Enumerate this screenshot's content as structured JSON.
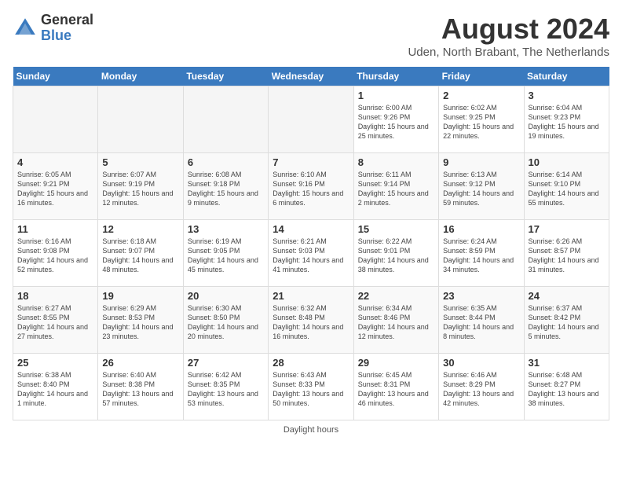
{
  "header": {
    "logo_general": "General",
    "logo_blue": "Blue",
    "title": "August 2024",
    "location": "Uden, North Brabant, The Netherlands"
  },
  "days_of_week": [
    "Sunday",
    "Monday",
    "Tuesday",
    "Wednesday",
    "Thursday",
    "Friday",
    "Saturday"
  ],
  "weeks": [
    [
      {
        "day": "",
        "info": ""
      },
      {
        "day": "",
        "info": ""
      },
      {
        "day": "",
        "info": ""
      },
      {
        "day": "",
        "info": ""
      },
      {
        "day": "1",
        "info": "Sunrise: 6:00 AM\nSunset: 9:26 PM\nDaylight: 15 hours\nand 25 minutes."
      },
      {
        "day": "2",
        "info": "Sunrise: 6:02 AM\nSunset: 9:25 PM\nDaylight: 15 hours\nand 22 minutes."
      },
      {
        "day": "3",
        "info": "Sunrise: 6:04 AM\nSunset: 9:23 PM\nDaylight: 15 hours\nand 19 minutes."
      }
    ],
    [
      {
        "day": "4",
        "info": "Sunrise: 6:05 AM\nSunset: 9:21 PM\nDaylight: 15 hours\nand 16 minutes."
      },
      {
        "day": "5",
        "info": "Sunrise: 6:07 AM\nSunset: 9:19 PM\nDaylight: 15 hours\nand 12 minutes."
      },
      {
        "day": "6",
        "info": "Sunrise: 6:08 AM\nSunset: 9:18 PM\nDaylight: 15 hours\nand 9 minutes."
      },
      {
        "day": "7",
        "info": "Sunrise: 6:10 AM\nSunset: 9:16 PM\nDaylight: 15 hours\nand 6 minutes."
      },
      {
        "day": "8",
        "info": "Sunrise: 6:11 AM\nSunset: 9:14 PM\nDaylight: 15 hours\nand 2 minutes."
      },
      {
        "day": "9",
        "info": "Sunrise: 6:13 AM\nSunset: 9:12 PM\nDaylight: 14 hours\nand 59 minutes."
      },
      {
        "day": "10",
        "info": "Sunrise: 6:14 AM\nSunset: 9:10 PM\nDaylight: 14 hours\nand 55 minutes."
      }
    ],
    [
      {
        "day": "11",
        "info": "Sunrise: 6:16 AM\nSunset: 9:08 PM\nDaylight: 14 hours\nand 52 minutes."
      },
      {
        "day": "12",
        "info": "Sunrise: 6:18 AM\nSunset: 9:07 PM\nDaylight: 14 hours\nand 48 minutes."
      },
      {
        "day": "13",
        "info": "Sunrise: 6:19 AM\nSunset: 9:05 PM\nDaylight: 14 hours\nand 45 minutes."
      },
      {
        "day": "14",
        "info": "Sunrise: 6:21 AM\nSunset: 9:03 PM\nDaylight: 14 hours\nand 41 minutes."
      },
      {
        "day": "15",
        "info": "Sunrise: 6:22 AM\nSunset: 9:01 PM\nDaylight: 14 hours\nand 38 minutes."
      },
      {
        "day": "16",
        "info": "Sunrise: 6:24 AM\nSunset: 8:59 PM\nDaylight: 14 hours\nand 34 minutes."
      },
      {
        "day": "17",
        "info": "Sunrise: 6:26 AM\nSunset: 8:57 PM\nDaylight: 14 hours\nand 31 minutes."
      }
    ],
    [
      {
        "day": "18",
        "info": "Sunrise: 6:27 AM\nSunset: 8:55 PM\nDaylight: 14 hours\nand 27 minutes."
      },
      {
        "day": "19",
        "info": "Sunrise: 6:29 AM\nSunset: 8:53 PM\nDaylight: 14 hours\nand 23 minutes."
      },
      {
        "day": "20",
        "info": "Sunrise: 6:30 AM\nSunset: 8:50 PM\nDaylight: 14 hours\nand 20 minutes."
      },
      {
        "day": "21",
        "info": "Sunrise: 6:32 AM\nSunset: 8:48 PM\nDaylight: 14 hours\nand 16 minutes."
      },
      {
        "day": "22",
        "info": "Sunrise: 6:34 AM\nSunset: 8:46 PM\nDaylight: 14 hours\nand 12 minutes."
      },
      {
        "day": "23",
        "info": "Sunrise: 6:35 AM\nSunset: 8:44 PM\nDaylight: 14 hours\nand 8 minutes."
      },
      {
        "day": "24",
        "info": "Sunrise: 6:37 AM\nSunset: 8:42 PM\nDaylight: 14 hours\nand 5 minutes."
      }
    ],
    [
      {
        "day": "25",
        "info": "Sunrise: 6:38 AM\nSunset: 8:40 PM\nDaylight: 14 hours\nand 1 minute."
      },
      {
        "day": "26",
        "info": "Sunrise: 6:40 AM\nSunset: 8:38 PM\nDaylight: 13 hours\nand 57 minutes."
      },
      {
        "day": "27",
        "info": "Sunrise: 6:42 AM\nSunset: 8:35 PM\nDaylight: 13 hours\nand 53 minutes."
      },
      {
        "day": "28",
        "info": "Sunrise: 6:43 AM\nSunset: 8:33 PM\nDaylight: 13 hours\nand 50 minutes."
      },
      {
        "day": "29",
        "info": "Sunrise: 6:45 AM\nSunset: 8:31 PM\nDaylight: 13 hours\nand 46 minutes."
      },
      {
        "day": "30",
        "info": "Sunrise: 6:46 AM\nSunset: 8:29 PM\nDaylight: 13 hours\nand 42 minutes."
      },
      {
        "day": "31",
        "info": "Sunrise: 6:48 AM\nSunset: 8:27 PM\nDaylight: 13 hours\nand 38 minutes."
      }
    ]
  ],
  "footer": "Daylight hours"
}
